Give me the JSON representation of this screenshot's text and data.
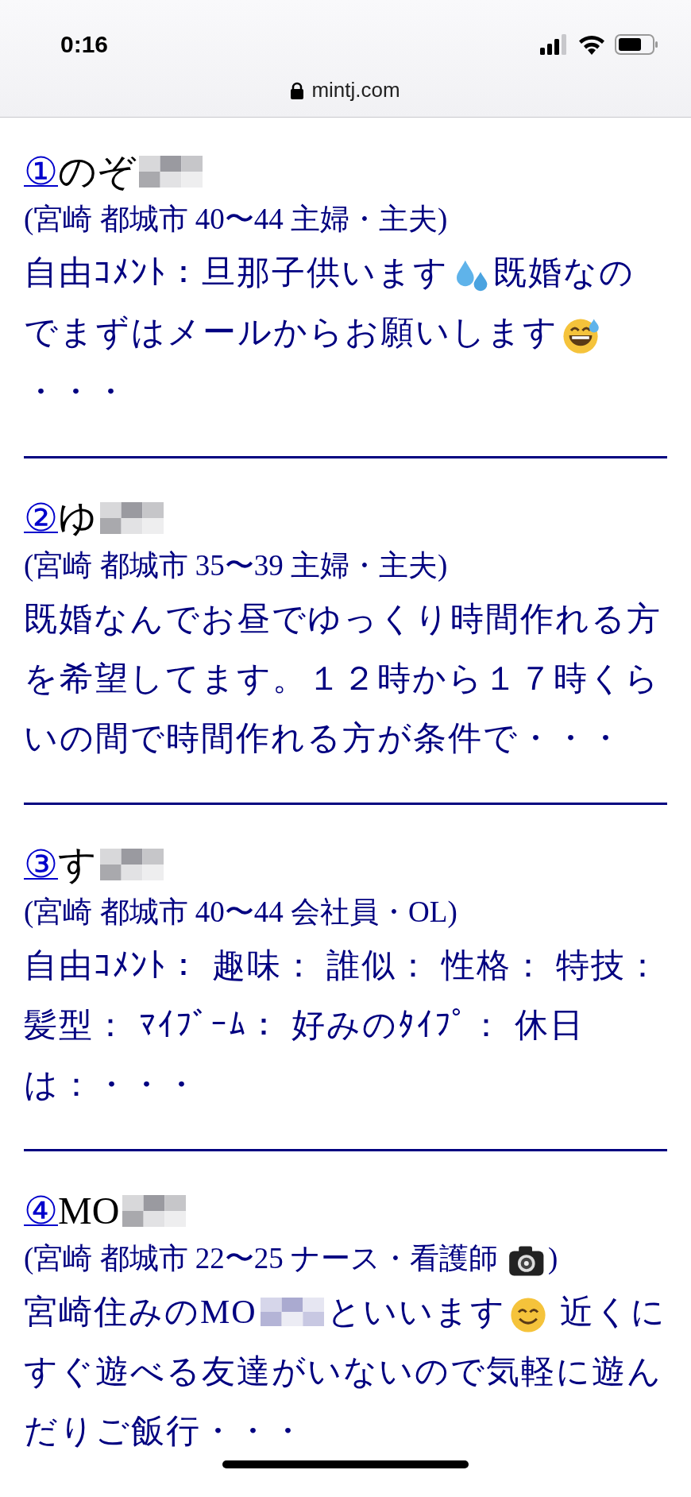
{
  "status_bar": {
    "time": "0:16",
    "url": "mintj.com"
  },
  "entries": [
    {
      "number": "①",
      "name": "のぞ",
      "name_blurred": true,
      "location": [
        {
          "kind": "text",
          "text": "(宮崎 都城市 40〜44 主婦・主夫)"
        }
      ],
      "comment": [
        {
          "kind": "text",
          "text": "自由ｺﾒﾝﾄ：旦那子供います"
        },
        {
          "kind": "sweat-drops"
        },
        {
          "kind": "text",
          "text": "既婚なのでまずはメールからお願いします"
        },
        {
          "kind": "sweat-smile"
        },
        {
          "kind": "text",
          "text": "・・・"
        }
      ]
    },
    {
      "number": "②",
      "name": "ゆ",
      "name_blurred": true,
      "location": [
        {
          "kind": "text",
          "text": "(宮崎 都城市 35〜39 主婦・主夫)"
        }
      ],
      "comment": [
        {
          "kind": "text",
          "text": "既婚なんでお昼でゆっくり時間作れる方を希望してます。１２時から１７時くらいの間で時間作れる方が条件で・・・"
        }
      ]
    },
    {
      "number": "③",
      "name": "す",
      "name_blurred": true,
      "location": [
        {
          "kind": "text",
          "text": "(宮崎 都城市 40〜44 会社員・OL)"
        }
      ],
      "comment": [
        {
          "kind": "text",
          "text": "自由ｺﾒﾝﾄ： 趣味： 誰似： 性格： 特技：髪型： ﾏｲﾌﾞｰﾑ： 好みのﾀｲﾌﾟ： 休日は：・・・"
        }
      ]
    },
    {
      "number": "④",
      "name": "MO",
      "name_blurred": true,
      "location": [
        {
          "kind": "text",
          "text": "(宮崎 都城市 22〜25 ナース・看護師 "
        },
        {
          "kind": "camera"
        },
        {
          "kind": "text",
          "text": ")"
        }
      ],
      "comment": [
        {
          "kind": "text",
          "text": "宮崎住みのMO"
        },
        {
          "kind": "blur"
        },
        {
          "kind": "text",
          "text": "といいます"
        },
        {
          "kind": "smile"
        },
        {
          "kind": "text",
          "text": " 近くにすぐ遊べる友達がいないので気軽に遊んだりご飯行・・・"
        }
      ]
    }
  ]
}
